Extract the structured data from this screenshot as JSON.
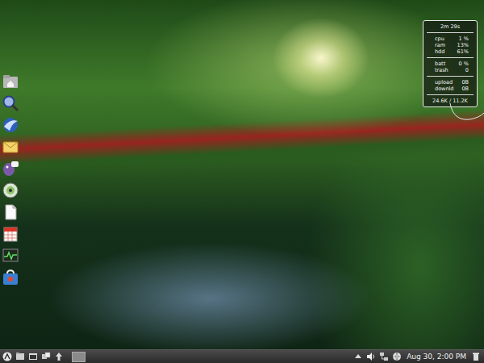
{
  "conky": {
    "uptime": "2m 29s",
    "groups": [
      [
        {
          "label": "cpu",
          "value": "1 %"
        },
        {
          "label": "ram",
          "value": "13%"
        },
        {
          "label": "hdd",
          "value": "61%"
        }
      ],
      [
        {
          "label": "batt",
          "value": "0 %"
        },
        {
          "label": "trash",
          "value": "0"
        }
      ],
      [
        {
          "label": "upload",
          "value": "0B"
        },
        {
          "label": "downld",
          "value": "0B"
        }
      ]
    ],
    "traffic": "24.6K / 11.2K"
  },
  "taskbar": {
    "clock": "Aug 30, 2:00 PM"
  }
}
